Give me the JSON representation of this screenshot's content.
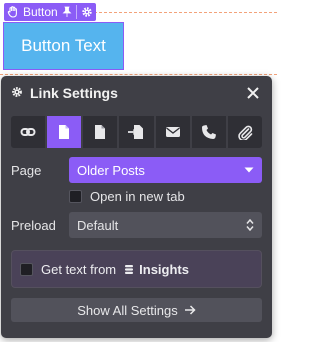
{
  "element_tag": {
    "label": "Button"
  },
  "canvas": {
    "button_text": "Button Text"
  },
  "panel": {
    "title": "Link Settings",
    "link_types": [
      {
        "icon": "link-icon"
      },
      {
        "icon": "page-icon"
      },
      {
        "icon": "file-icon"
      },
      {
        "icon": "file-import-icon"
      },
      {
        "icon": "envelope-icon"
      },
      {
        "icon": "phone-icon"
      },
      {
        "icon": "paperclip-icon"
      }
    ],
    "active_type": "page-icon",
    "page_label": "Page",
    "page_value": "Older Posts",
    "new_tab_label": "Open in new tab",
    "preload_label": "Preload",
    "preload_value": "Default",
    "dynamic_prefix": "Get text from",
    "dynamic_source": "Insights",
    "show_all_label": "Show All Settings"
  },
  "colors": {
    "accent": "#8b5cf6",
    "panel_bg": "#3f3f46",
    "button_bg": "#55b4ee"
  }
}
